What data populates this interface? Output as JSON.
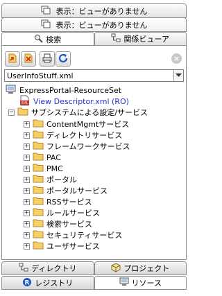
{
  "top_tabs": [
    {
      "label": "表示：ビューがありません"
    },
    {
      "label": "表示：ビューがありません"
    }
  ],
  "view_tabs": [
    {
      "label": "検索",
      "icon": "magnifier-icon"
    },
    {
      "label": "関係ビューア",
      "icon": "relationship-icon"
    }
  ],
  "toolbar": {
    "buttons": [
      "new-icon",
      "delete-icon",
      "print-icon",
      "refresh-icon"
    ],
    "close": "×"
  },
  "selector": {
    "value": "UserInfoStuff.xml"
  },
  "tree": {
    "root": "ExpressPortal-ResourceSet",
    "descriptor": "View Descriptor.xml (RO)",
    "group": "サブシステムによる設定/サービス",
    "items": [
      "ContentMgmtサービス",
      "ディレクトリサービス",
      "フレームワークサービス",
      "PAC",
      "PMC",
      "ポータル",
      "ポータルサービス",
      "RSSサービス",
      "ルールサービス",
      "検索サービス",
      "セキュリティサービス",
      "ユーザサービス"
    ]
  },
  "bottom_tabs": {
    "row1": [
      {
        "label": "ディレクトリ",
        "icon": "directory-icon"
      },
      {
        "label": "プロジェクト",
        "icon": "project-icon"
      }
    ],
    "row2": [
      {
        "label": "レジストリ",
        "icon": "registry-icon"
      },
      {
        "label": "リソース",
        "icon": "resource-icon"
      }
    ]
  },
  "colors": {
    "folder": "#f2c94c",
    "link": "#2233cc",
    "accent_blue": "#1a56c8"
  }
}
